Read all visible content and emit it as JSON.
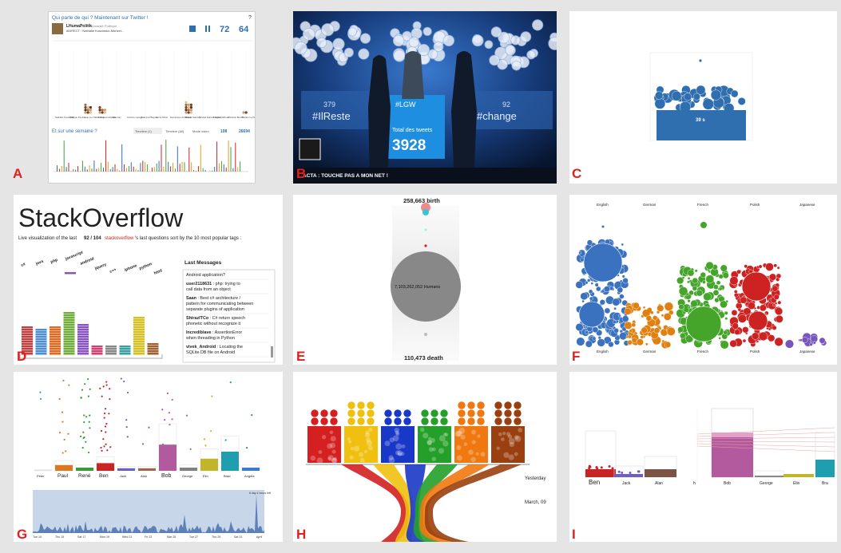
{
  "panels": {
    "A": {
      "label": "A",
      "title": "Qui parle de qui ? Maintenant sur Twitter !",
      "help": "?",
      "user_name": "LHumaPolitik",
      "user_handle": "l'Humanité Politique",
      "tweet_text": "#DIRECT : Nathalie Kosciusko-Morizet...",
      "stat1": "72",
      "stat2": "64",
      "candidates": [
        "Nathalie Kosciusko",
        "Philippe Poutou",
        "Jean-Luc Mélenchon",
        "François Hollande",
        "Eva Joly",
        "Corinne Lepage",
        "François Bayrou",
        "Hervé Morin",
        "Dominique de Villepin",
        "Nicolas Sarkozy",
        "Nicolas Dupont-Aignan",
        "Frédéric Nihous",
        "Christine Boutin",
        "Marine Le Pen"
      ],
      "section_title": "Et sur une semaine ?",
      "tabs": [
        "Timeline (1)",
        "Timeline (All)",
        "Mode video"
      ],
      "count1": "108",
      "count2": "26694"
    },
    "B": {
      "label": "B",
      "hashtag": "#LGW",
      "total_label": "Total des tweets",
      "total_value": "3928",
      "left_count": "379",
      "left_tag": "#IlReste",
      "right_count": "92",
      "right_tag": "#change",
      "caption": "ACTA : TOUCHE PAS A MON NET !"
    },
    "C": {
      "label": "C",
      "timer": "39 s"
    },
    "D": {
      "label": "D",
      "title": "StackOverflow",
      "subtitle_pre": "Live visualization of the last",
      "count": "92 / 104",
      "link": "stackoverflow",
      "subtitle_post": "'s last questions sort by the 10 most popular tags :",
      "tags": [
        "c#",
        "java",
        "php",
        "javascript",
        "android",
        "jquery",
        "c++",
        "iphone",
        "python",
        "html"
      ],
      "messages_title": "Last Messages",
      "messages": [
        {
          "user": "",
          "text": "Android application?"
        },
        {
          "user": "user2118631",
          "text": " : php: trying to call data from an object"
        },
        {
          "user": "Saan",
          "text": " : Best c# architecture / pattern for communicating between separate plugins of application"
        },
        {
          "user": "ShirazITCo",
          "text": " : C# return speech phonetic without recognize it"
        },
        {
          "user": "Incrediblave",
          "text": " : AssertionError when threading in Python"
        },
        {
          "user": "vivek_Android",
          "text": " : Locating the SQLite DB file on Android"
        }
      ]
    },
    "E": {
      "label": "E",
      "birth": "258,663 birth",
      "humans": "7,103,262,052 Humans",
      "death": "110,473 death"
    },
    "F": {
      "label": "F",
      "languages": [
        "English",
        "German",
        "French",
        "Polish",
        "Japanese"
      ]
    },
    "G": {
      "label": "G",
      "names": [
        "Peter",
        "Paul",
        "René",
        "Ben",
        "Jack",
        "Alan",
        "Bob",
        "George",
        "Elin",
        "Brad",
        "Angela"
      ],
      "annotation": "6 day 4 hours left",
      "dates": [
        "Tue 10",
        "Thu 15",
        "Sat 17",
        "Mon 19",
        "Wed 21",
        "Fri 23",
        "Mar 25",
        "Tue 27",
        "Thu 29",
        "Sat 31",
        "April"
      ],
      "bar_values": [
        2,
        18,
        10,
        24,
        8,
        8,
        82,
        10,
        38,
        60,
        10
      ],
      "bar_colors": [
        "#d8d8d8",
        "#e07520",
        "#3a9a38",
        "#c82424",
        "#6b60c0",
        "#9a6a50",
        "#b35a9e",
        "#808080",
        "#c2b52a",
        "#1f9eb0",
        "#3a7ac8"
      ]
    },
    "H": {
      "label": "H",
      "yesterday": "Yesterday",
      "date": "March, 09"
    },
    "I": {
      "label": "I",
      "names_left": [
        "Ben",
        "Jack",
        "Alan"
      ],
      "names_right": [
        "Bob",
        "George",
        "Elin",
        "Bra"
      ]
    }
  },
  "colors": {
    "label": "#e0201c",
    "twitter_blue": "#2f6fb0",
    "stack_red": "#d0201c"
  }
}
